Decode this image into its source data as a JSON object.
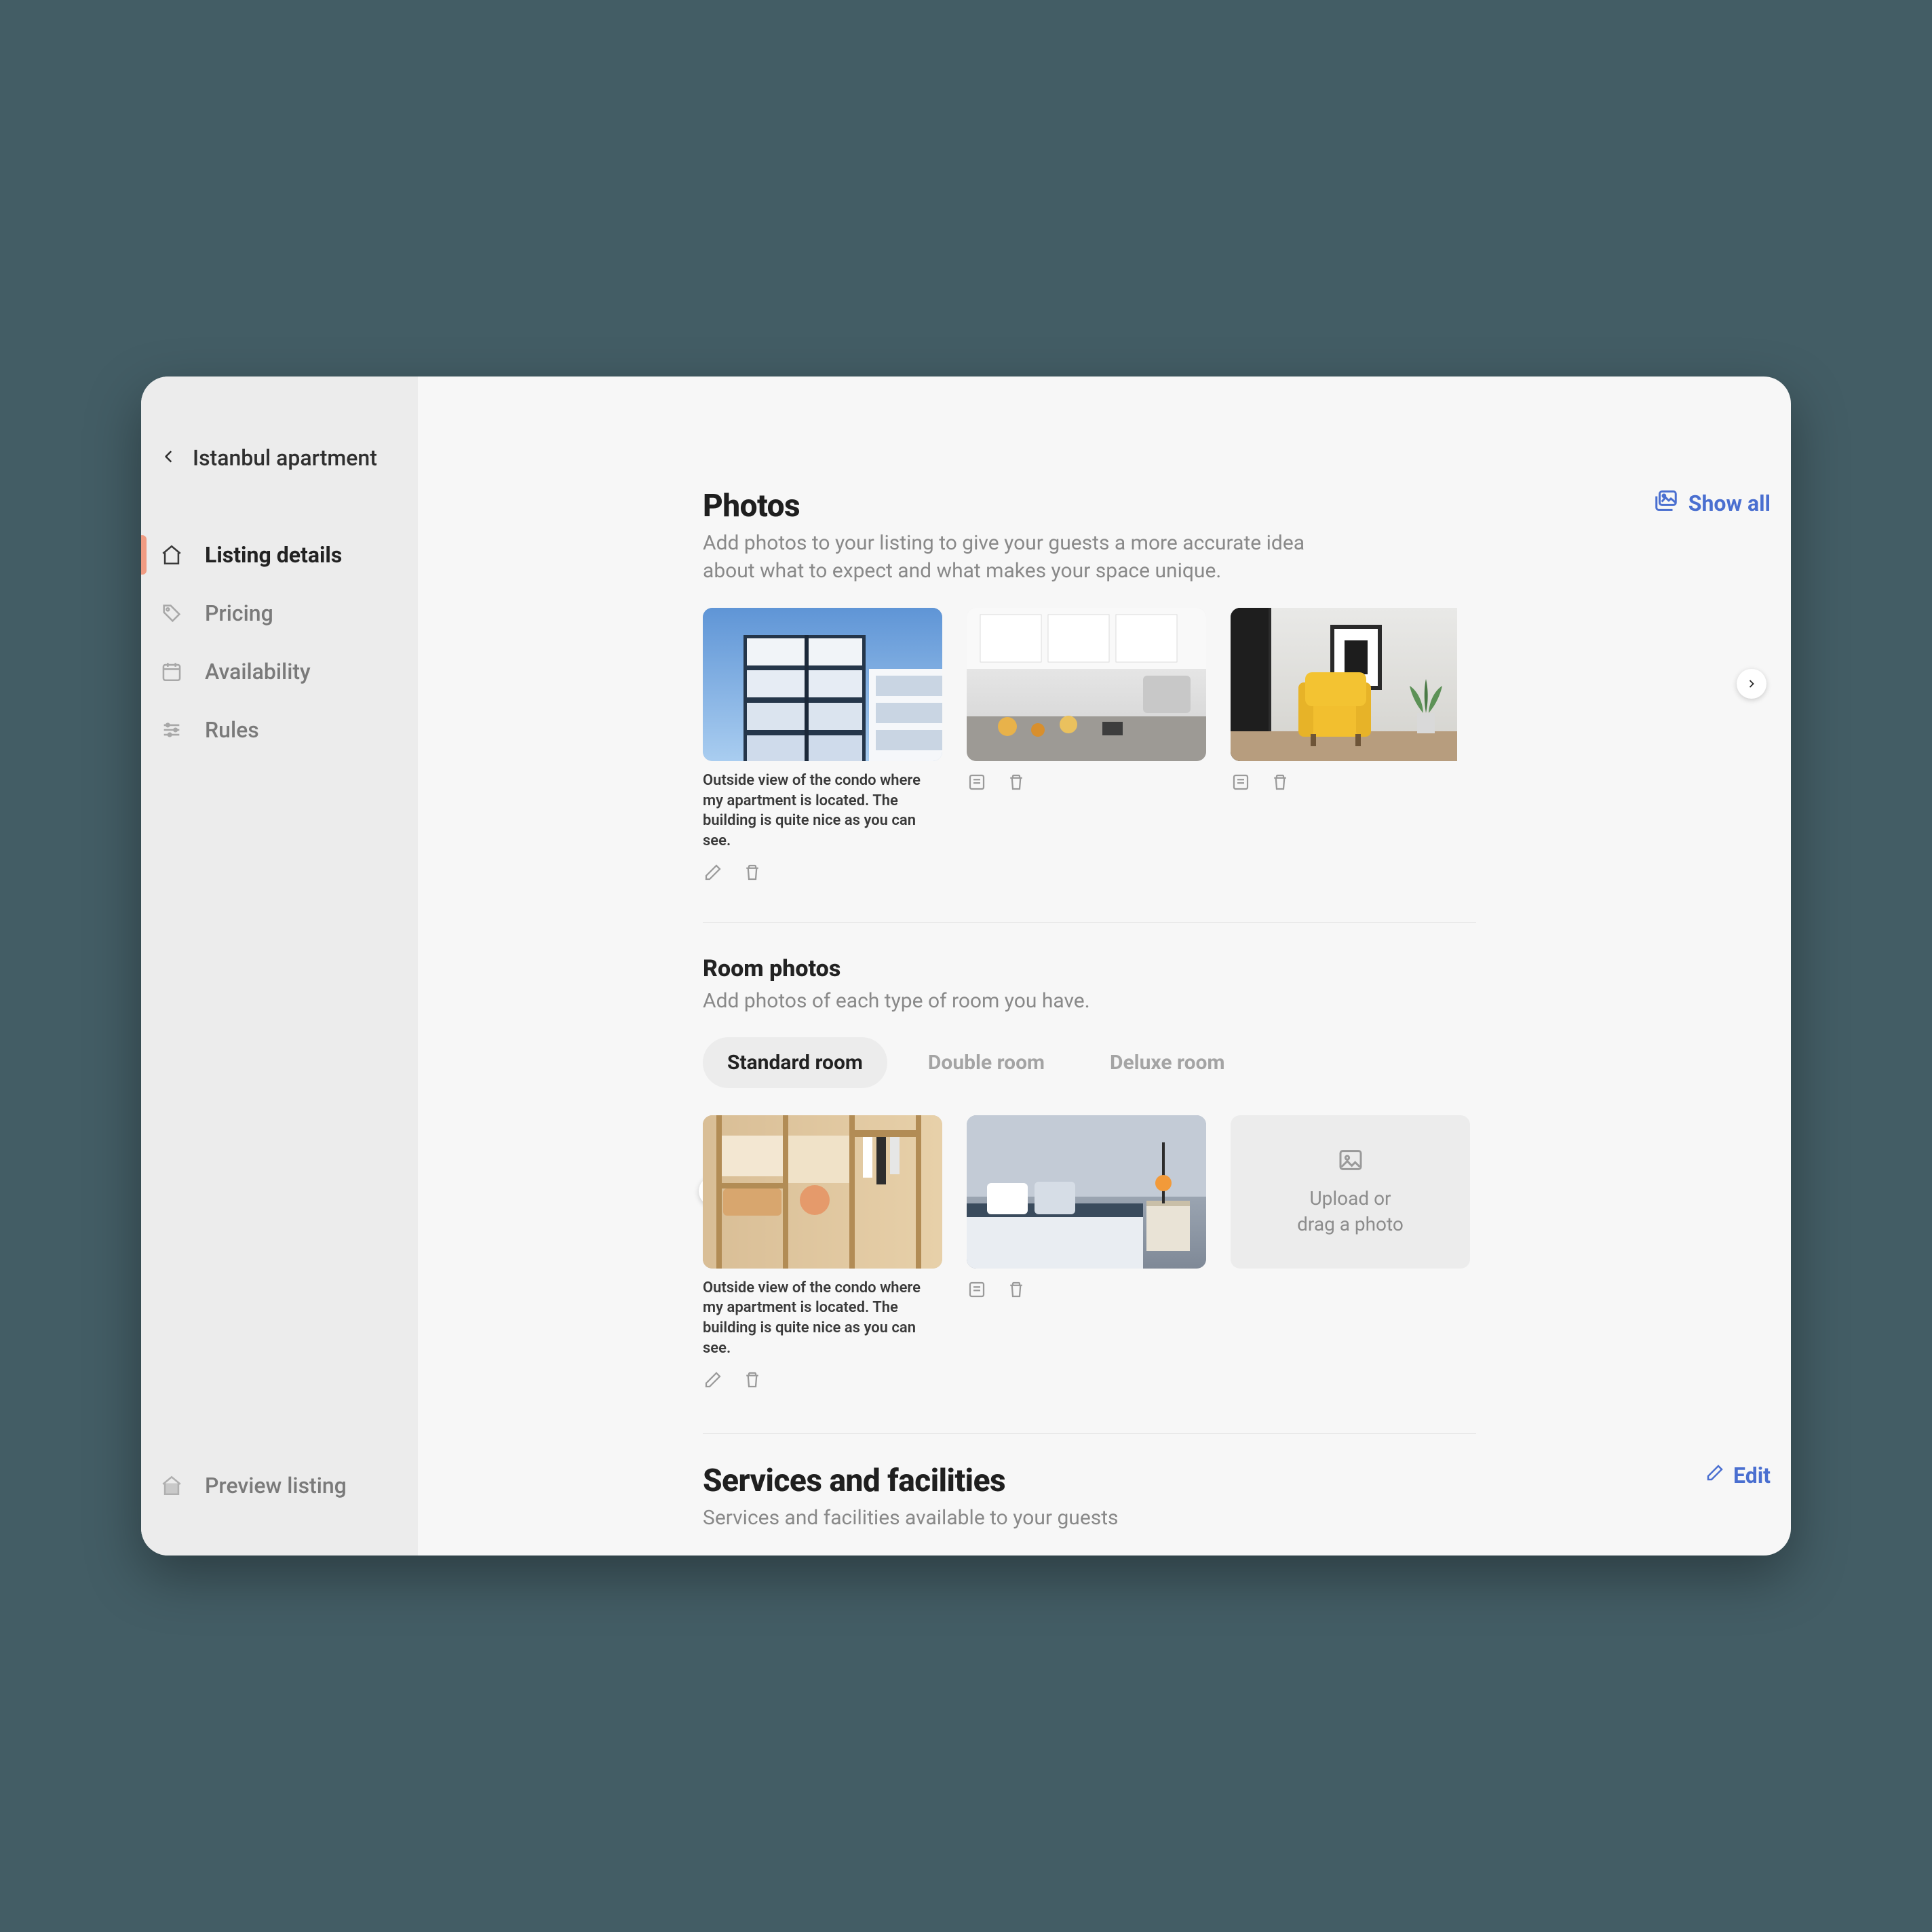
{
  "sidebar": {
    "back_label": "Istanbul apartment",
    "items": [
      {
        "label": "Listing details",
        "active": true
      },
      {
        "label": "Pricing"
      },
      {
        "label": "Availability"
      },
      {
        "label": "Rules"
      }
    ],
    "footer_label": "Preview listing"
  },
  "photos": {
    "title": "Photos",
    "description": "Add photos to your listing to give your guests a more accurate idea about what to expect and what makes your space unique.",
    "show_all_label": "Show all",
    "cards": [
      {
        "caption": "Outside view of the condo where my apartment is located. The building is quite nice as you can see."
      },
      {},
      {}
    ]
  },
  "room_photos": {
    "title": "Room photos",
    "description": "Add photos of each type of room you have.",
    "tabs": [
      {
        "label": "Standard room",
        "active": true
      },
      {
        "label": "Double room"
      },
      {
        "label": "Deluxe room"
      }
    ],
    "cards": [
      {
        "caption": "Outside view of the condo where my apartment is located. The building is quite nice as you can see."
      },
      {}
    ],
    "upload_line1": "Upload or",
    "upload_line2": "drag a photo"
  },
  "services": {
    "title": "Services and facilities",
    "description": "Services and facilities available to your guests",
    "edit_label": "Edit"
  }
}
